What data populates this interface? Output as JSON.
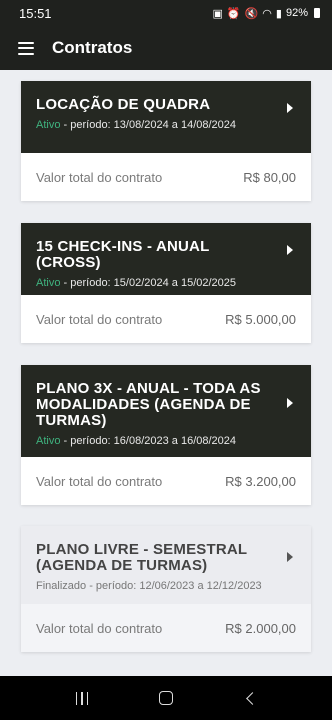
{
  "status_bar": {
    "time": "15:51",
    "battery": "92%"
  },
  "app_bar": {
    "title": "Contratos"
  },
  "contracts": [
    {
      "title": "LOCAÇÃO DE QUADRA",
      "status": "Ativo",
      "period": "- período: 13/08/2024 a 14/08/2024",
      "total_label": "Valor total do contrato",
      "total_value": "R$ 80,00"
    },
    {
      "title": "15 CHECK-INS - ANUAL (CROSS)",
      "status": "Ativo",
      "period": "- período: 15/02/2024 a 15/02/2025",
      "total_label": "Valor total do contrato",
      "total_value": "R$ 5.000,00"
    },
    {
      "title": "PLANO 3X - ANUAL - TODA AS MODALIDADES (AGENDA DE TURMAS)",
      "status": "Ativo",
      "period": "- período: 16/08/2023 a 16/08/2024",
      "total_label": "Valor total do contrato",
      "total_value": "R$ 3.200,00"
    },
    {
      "title": "PLANO LIVRE - SEMESTRAL (AGENDA DE TURMAS)",
      "status": "Finalizado",
      "period": "- período: 12/06/2023 a 12/12/2023",
      "total_label": "Valor total do contrato",
      "total_value": "R$ 2.000,00"
    }
  ],
  "colors": {
    "header_dark": "#1f211e",
    "active_green": "#3fb37f",
    "finished_bg": "#ebecf0"
  }
}
